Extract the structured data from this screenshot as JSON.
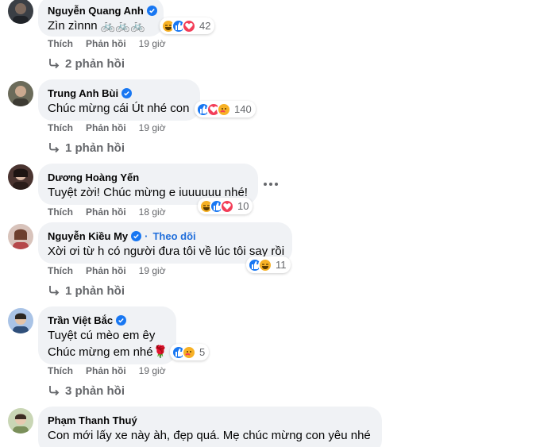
{
  "comments": [
    {
      "author": "Nguyễn Quang Anh",
      "text_lines": [
        "Zìn zìnnn 🚲🚲🚲"
      ],
      "reactions": [
        "haha",
        "like",
        "love"
      ],
      "reaction_count": "42",
      "like_label": "Thích",
      "reply_label": "Phản hồi",
      "time": "19 giờ",
      "replies_label": "2 phản hồi"
    },
    {
      "author": "Trung Anh Bùi",
      "text_lines": [
        "Chúc mừng cái Út nhé con"
      ],
      "reactions": [
        "like",
        "love",
        "care"
      ],
      "reaction_count": "140",
      "like_label": "Thích",
      "reply_label": "Phản hồi",
      "time": "19 giờ",
      "replies_label": "1 phản hồi"
    },
    {
      "author": "Dương Hoàng Yến",
      "text_lines": [
        "Tuyệt zời! Chúc mừng e iuuuuuu nhé!"
      ],
      "reactions": [
        "haha",
        "like",
        "love"
      ],
      "reaction_count": "10",
      "like_label": "Thích",
      "reply_label": "Phản hồi",
      "time": "18 giờ"
    },
    {
      "author": "Nguyễn Kiều My",
      "follow_label": "Theo dõi",
      "text_lines": [
        "Xời ơi từ h có người đưa tôi về lúc tôi say rồi"
      ],
      "reactions": [
        "like",
        "haha"
      ],
      "reaction_count": "11",
      "like_label": "Thích",
      "reply_label": "Phản hồi",
      "time": "19 giờ",
      "replies_label": "1 phản hồi"
    },
    {
      "author": "Trần Việt Bắc",
      "text_lines": [
        "Tuyệt cú mèo em êy",
        "Chúc mừng em nhé🌹"
      ],
      "reactions": [
        "like",
        "care"
      ],
      "reaction_count": "5",
      "like_label": "Thích",
      "reply_label": "Phản hồi",
      "time": "19 giờ",
      "replies_label": "3 phản hồi"
    },
    {
      "author": "Phạm Thanh Thuý",
      "text_lines": [
        "Con mới lấy xe này àh, đẹp quá. Mẹ chúc mừng con yêu nhé"
      ]
    }
  ],
  "colors": {
    "bubble": "#f0f2f5",
    "verified": "#1877f2",
    "like": "#1877f2",
    "love": "#f33e58",
    "haha": "#f7b125",
    "link": "#216fdb",
    "meta": "#65676b"
  },
  "icons": {
    "verified": "verified-badge-icon",
    "reply": "reply-arrow-icon",
    "more": "more-options-icon"
  }
}
